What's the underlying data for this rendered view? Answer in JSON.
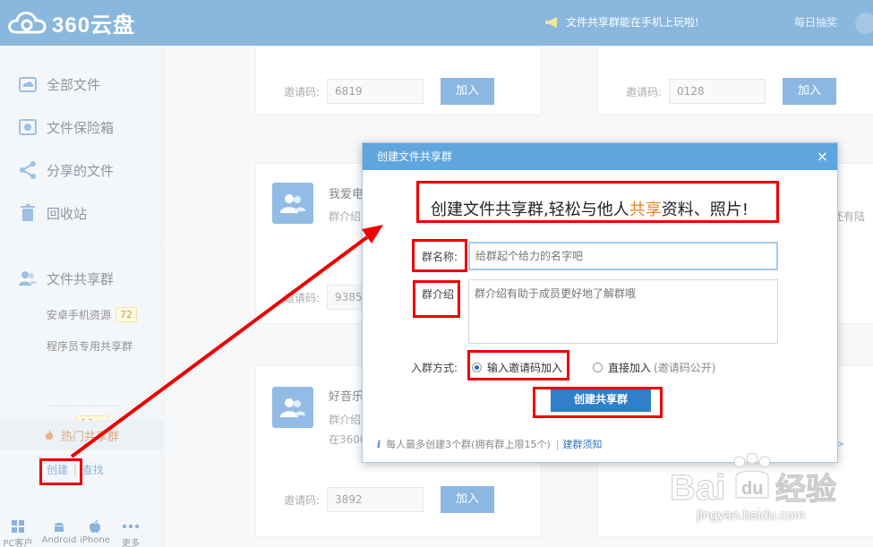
{
  "header": {
    "logo_text": "360云盘",
    "notice": "文件共享群能在手机上玩啦!",
    "daily": "每日抽奖"
  },
  "sidebar": {
    "nav": [
      {
        "label": "全部文件",
        "icon": "cloud-icon"
      },
      {
        "label": "文件保险箱",
        "icon": "safe-icon"
      },
      {
        "label": "分享的文件",
        "icon": "share-icon"
      },
      {
        "label": "回收站",
        "icon": "trash-icon"
      }
    ],
    "group_section": "文件共享群",
    "groups": [
      {
        "label": "安卓手机资源",
        "badge": "72"
      },
      {
        "label": "程序员专用共享群",
        "badge": ""
      }
    ],
    "more_dots": "•••",
    "more_badge": "99+",
    "hot": "热门共享群",
    "create": "创建",
    "divider": "|",
    "find": "查找",
    "clients": [
      {
        "label": "PC客户端",
        "icon": "windows-icon"
      },
      {
        "label": "Android",
        "icon": "android-icon"
      },
      {
        "label": "iPhone",
        "icon": "apple-icon"
      },
      {
        "label": "更多",
        "icon": "more-icon"
      }
    ]
  },
  "cards": [
    {
      "code_label": "邀请码:",
      "code": "6819",
      "join": "加入"
    },
    {
      "code_label": "邀请码:",
      "code": "0128",
      "join": "加入"
    },
    {
      "title": "我爱电",
      "desc": "群介绍",
      "code_label": "邀请码:",
      "code": "9385"
    },
    {
      "title": "好音乐",
      "desc1": "群介绍",
      "desc2": "在3600",
      "code_label": "邀请码:",
      "code": "3892",
      "join": "加入"
    }
  ],
  "right_snippet": "还有陆",
  "right_arrow": ">",
  "dialog": {
    "title": "创建文件共享群",
    "close": "×",
    "slogan_a": "创建文件共享群,轻松与他人",
    "slogan_hl": "共享",
    "slogan_b": "资料、照片!",
    "name_label": "群名称:",
    "name_placeholder": "给群起个给力的名字吧",
    "intro_label": "群介绍",
    "intro_placeholder": "群介绍有助于成员更好地了解群哦",
    "join_label": "入群方式:",
    "opt_code": "输入邀请码加入",
    "opt_direct": "直接加入",
    "opt_direct_note": "(邀请码公开)",
    "create_button": "创建共享群",
    "foot_info": "i",
    "foot_text": "每人最多创建3个群(拥有群上限15个)",
    "foot_divider": "|",
    "foot_link": "建群须知"
  },
  "watermark": {
    "brand": "Baidu经验",
    "url": "jingyan.baidu.com"
  },
  "colors": {
    "header": "#2a7cc4",
    "accent": "#2d7cc8",
    "annotation": "#ee0000",
    "highlight": "#e8821e"
  }
}
